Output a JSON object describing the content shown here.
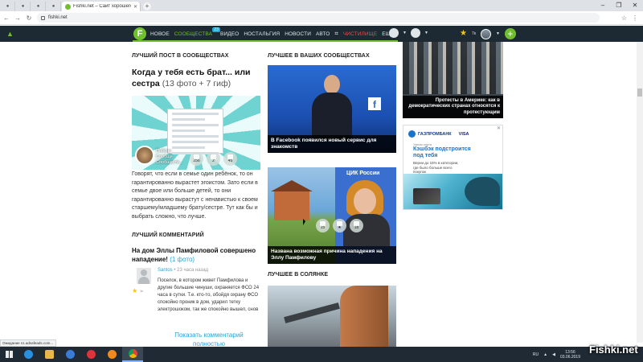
{
  "browser": {
    "active_tab_title": "Fishki.net – Сайт хорошего нас",
    "address": "fishki.net",
    "new_tab_symbol": "+",
    "window_controls": [
      "–",
      "❐",
      "✕"
    ]
  },
  "site_nav": {
    "logo": "F",
    "items": [
      {
        "label": "НОВОЕ",
        "state": "normal"
      },
      {
        "label": "СООБЩЕСТВА",
        "state": "active",
        "badge": "23"
      },
      {
        "label": "ВИДЕО",
        "state": "normal"
      },
      {
        "label": "НОСТАЛЬГИЯ",
        "state": "normal"
      },
      {
        "label": "НОВОСТИ",
        "state": "normal"
      },
      {
        "label": "АВТО",
        "state": "normal"
      }
    ],
    "special": "ЧИСТИЛИЩЕ",
    "more": "ЕЩЁ",
    "rank": "7к",
    "colors": {
      "header_bg": "#1d2a33",
      "accent_green": "#6fbf2f",
      "link_blue": "#2aa4d9",
      "special_red": "#f0484e"
    }
  },
  "best_post": {
    "section": "ЛУЧШИЙ ПОСТ В СООБЩЕСТВАХ",
    "title": "Когда у тебя есть брат... или сестра",
    "meta": "(13 фото + 7 гиф)",
    "overlay_text": [
      "Побочн",
      "Сообще",
      "Сообщесте..."
    ],
    "stats": [
      "256",
      "2",
      "45"
    ],
    "body": "Говорят, что если в семье один ребёнок, то он гарантированно вырастет эгоистом. Зато если в семье двое или больше детей, то они гарантированно вырастут с ненавистью к своем старшему/младшему брату/сестре. Тут как бы и выбрать сложно, что лучше."
  },
  "best_comment": {
    "section": "ЛУЧШИЙ КОММЕНТАРИЙ",
    "title": "На дом Эллы Памфиловой совершено нападение!",
    "meta": "(1 фото)",
    "user": "Santos",
    "time": "23 часа назад",
    "rank": "1к",
    "text": "Поселок, в котором живет Памфилова и другие большие чинуши, охраняется ФСО 24 часа в сутки. Т.е. кто-то, обойдя охрану ФСО спокойно проник в дом, ударил тетку электрошоком, так же спокойно вышел, снов",
    "show_full": "Показать комментарий полностью"
  },
  "your_communities": {
    "section": "ЛУЧШЕЕ В ВАШИХ СООБЩЕСТВАХ",
    "cards": [
      {
        "caption": "В Facebook появился новый сервис для знакомств"
      },
      {
        "caption": "Названа возможная причина нападения на Эллу Памфилову",
        "stats": [
          "15",
          "★",
          "18"
        ],
        "image_label": "ЦИК России"
      }
    ]
  },
  "solyanka": {
    "section": "ЛУЧШЕЕ В СОЛЯНКЕ"
  },
  "sidebar": {
    "top_card_caption": "Протесты в Америке: как в демократических странах относятся к протестующим",
    "ad": {
      "bank": "ГАЗПРОМБАНК",
      "network": "VISA",
      "small": "Умная карта",
      "headline": "Кэшбэк подстроится под тебя",
      "sub": "Верни до 15% в категории, где было больше всего покупок",
      "close": "✕"
    }
  },
  "status_bar": "Ожидание s1.adsafeads.com...",
  "taskbar": {
    "lang": "RU",
    "time": "13:56",
    "date": "03.06.2019"
  },
  "watermark": "Fishki.net"
}
